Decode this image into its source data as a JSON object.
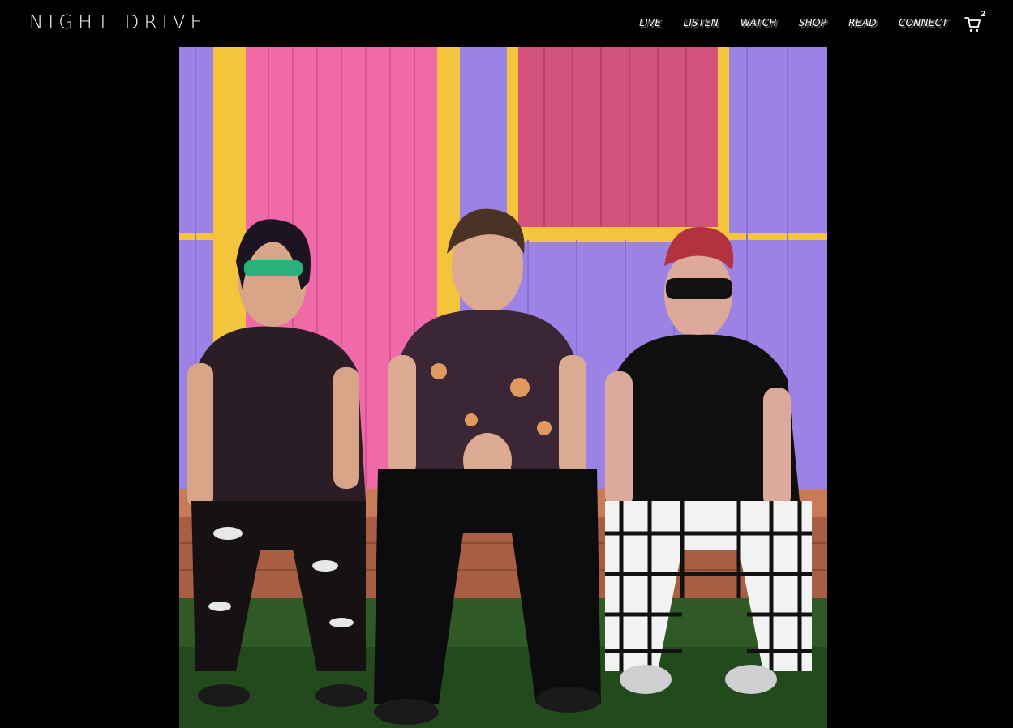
{
  "brand": {
    "logo_text": "NIGHT DRIVE"
  },
  "nav": {
    "items": [
      "LIVE",
      "LISTEN",
      "WATCH",
      "SHOP",
      "READ",
      "CONNECT"
    ]
  },
  "cart": {
    "icon": "cart-icon",
    "count": "2"
  },
  "hero": {
    "image": "band-photo",
    "colors": {
      "wall_purple": "#9d82e6",
      "door_pink": "#f06aa9",
      "trim_yellow": "#f3c43c",
      "grass_green": "#2f5a26",
      "bench_wood": "#b7684a"
    }
  }
}
